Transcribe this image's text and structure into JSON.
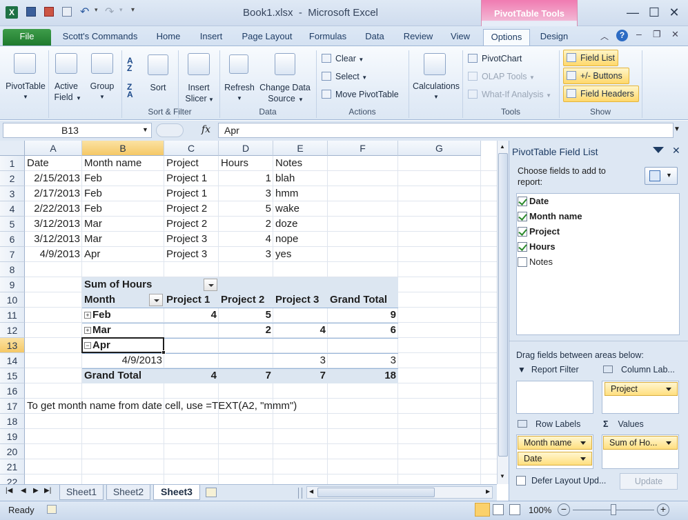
{
  "title": {
    "text": "Book1.xlsx  -  Microsoft Excel",
    "context_tools": "PivotTable Tools"
  },
  "qat": {
    "save": "save-icon",
    "undo": "undo-icon",
    "redo": "redo-icon"
  },
  "tabs": [
    "File",
    "Scott's Commands",
    "Home",
    "Insert",
    "Page Layout",
    "Formulas",
    "Data",
    "Review",
    "View",
    "Options",
    "Design"
  ],
  "ribbon": {
    "pivottable": "PivotTable",
    "active_field_1": "Active",
    "active_field_2": "Field",
    "group": "Group",
    "sort": "Sort",
    "insert_slicer_1": "Insert",
    "insert_slicer_2": "Slicer",
    "refresh": "Refresh",
    "change_source_1": "Change Data",
    "change_source_2": "Source",
    "clear": "Clear",
    "select": "Select",
    "move_pivottable": "Move PivotTable",
    "calculations": "Calculations",
    "pivotchart": "PivotChart",
    "olap_tools": "OLAP Tools",
    "whatif": "What-If Analysis",
    "field_list": "Field List",
    "buttons": "+/- Buttons",
    "field_headers": "Field Headers",
    "groups": {
      "sort_filter": "Sort & Filter",
      "data": "Data",
      "actions": "Actions",
      "tools": "Tools",
      "show": "Show"
    }
  },
  "formula_bar": {
    "name_box": "B13",
    "fx": "fx",
    "value": "Apr"
  },
  "columns": [
    "A",
    "B",
    "C",
    "D",
    "E",
    "F",
    "G"
  ],
  "rows": [
    "1",
    "2",
    "3",
    "4",
    "5",
    "6",
    "7",
    "8",
    "9",
    "10",
    "11",
    "12",
    "13",
    "14",
    "15",
    "16",
    "17",
    "18",
    "19",
    "20",
    "21",
    "22"
  ],
  "data_table": {
    "headers": [
      "Date",
      "Month name",
      "Project",
      "Hours",
      "Notes"
    ],
    "rows": [
      [
        "2/15/2013",
        "Feb",
        "Project 1",
        "1",
        "blah"
      ],
      [
        "2/17/2013",
        "Feb",
        "Project 1",
        "3",
        "hmm"
      ],
      [
        "2/22/2013",
        "Feb",
        "Project 2",
        "5",
        "wake"
      ],
      [
        "3/12/2013",
        "Mar",
        "Project 2",
        "2",
        "doze"
      ],
      [
        "3/12/2013",
        "Mar",
        "Project 3",
        "4",
        "nope"
      ],
      [
        "4/9/2013",
        "Apr",
        "Project 3",
        "3",
        "yes"
      ]
    ]
  },
  "pivot": {
    "title": "Sum of Hours",
    "row_label": "Month",
    "col_headers": [
      "Project 1",
      "Project 2",
      "Project 3",
      "Grand Total"
    ],
    "rows": [
      {
        "label": "Feb",
        "exp": "+",
        "values": [
          "4",
          "5",
          "",
          "9"
        ]
      },
      {
        "label": "Mar",
        "exp": "+",
        "values": [
          "",
          "2",
          "4",
          "6"
        ]
      },
      {
        "label": "Apr",
        "exp": "−",
        "values": [
          "",
          "",
          "",
          ""
        ]
      },
      {
        "label": "4/9/2013",
        "exp": "",
        "values": [
          "",
          "",
          "3",
          "3"
        ]
      }
    ],
    "grand_total": {
      "label": "Grand Total",
      "values": [
        "4",
        "7",
        "7",
        "18"
      ]
    }
  },
  "note": "To get month name from date cell, use =TEXT(A2, \"mmm\")",
  "sheets": [
    "Sheet1",
    "Sheet2",
    "Sheet3"
  ],
  "status": {
    "ready": "Ready",
    "zoom": "100%"
  },
  "field_list": {
    "title": "PivotTable Field List",
    "choose": "Choose fields to add to report:",
    "fields": [
      {
        "name": "Date",
        "checked": true
      },
      {
        "name": "Month name",
        "checked": true
      },
      {
        "name": "Project",
        "checked": true
      },
      {
        "name": "Hours",
        "checked": true
      },
      {
        "name": "Notes",
        "checked": false
      }
    ],
    "drag_label": "Drag fields between areas below:",
    "report_filter": "Report Filter",
    "column_labels": "Column Lab...",
    "row_labels": "Row Labels",
    "values": "Values",
    "column_chip": "Project",
    "row_chip_1": "Month name",
    "row_chip_2": "Date",
    "value_chip": "Sum of Ho...",
    "defer": "Defer Layout Upd...",
    "update": "Update"
  }
}
